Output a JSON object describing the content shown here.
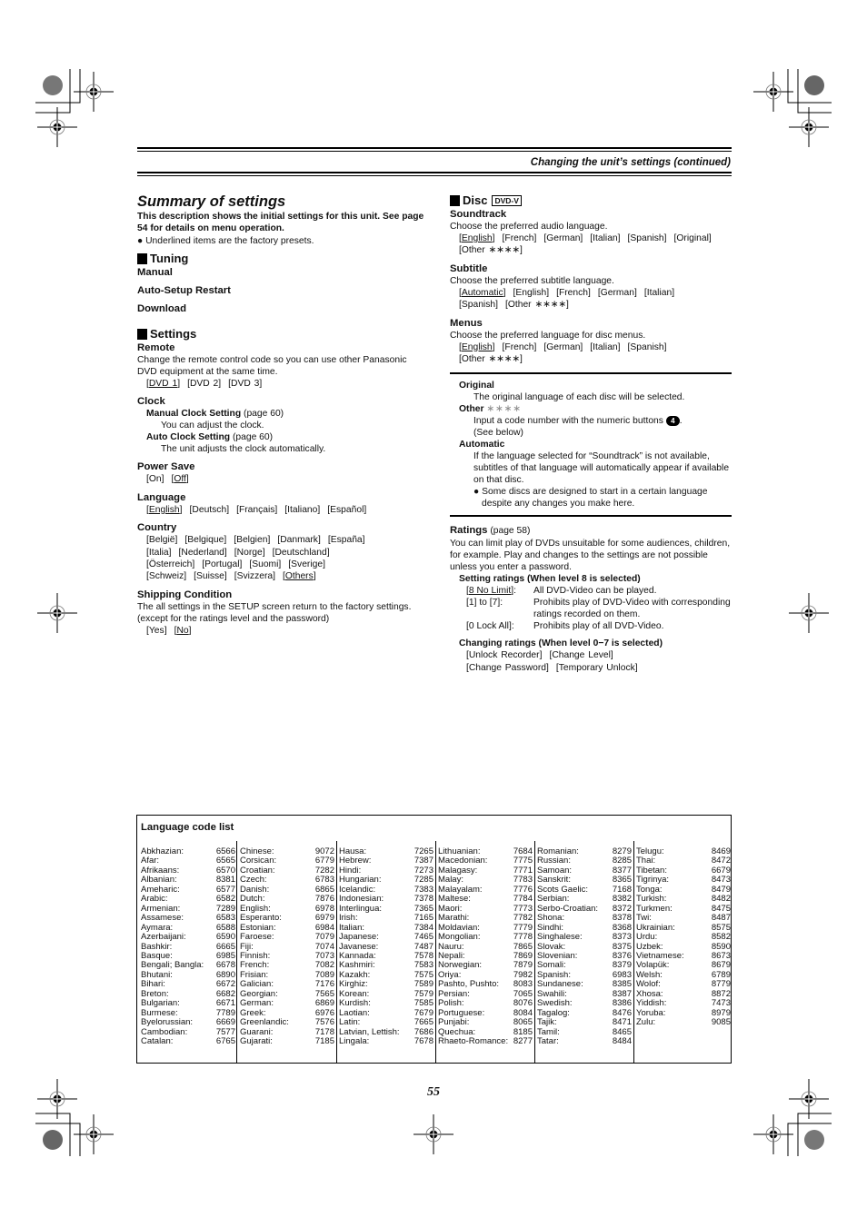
{
  "header": {
    "running_title": "Changing the unit’s settings (continued)"
  },
  "left": {
    "title": "Summary of settings",
    "intro": "This description shows the initial settings for this unit. See page 54 for details on menu operation.",
    "note": "Underlined items are the factory presets.",
    "tuning": {
      "heading": "Tuning",
      "items": [
        "Manual",
        "Auto-Setup Restart",
        "Download"
      ]
    },
    "settings": {
      "heading": "Settings",
      "remote": {
        "label": "Remote",
        "desc": "Change the remote control code so you can use other Panasonic DVD equipment at the same time.",
        "options": [
          {
            "label": "DVD 1",
            "default": true
          },
          {
            "label": "DVD 2",
            "default": false
          },
          {
            "label": "DVD 3",
            "default": false
          }
        ]
      },
      "clock": {
        "label": "Clock",
        "manual_label": "Manual Clock Setting",
        "manual_ref": "(page 60)",
        "manual_desc": "You can adjust the clock.",
        "auto_label": "Auto Clock Setting",
        "auto_ref": "(page 60)",
        "auto_desc": "The unit adjusts the clock automatically."
      },
      "power_save": {
        "label": "Power Save",
        "options": [
          {
            "label": "On",
            "default": false
          },
          {
            "label": "Off",
            "default": true
          }
        ]
      },
      "language": {
        "label": "Language",
        "options": [
          {
            "label": "English",
            "default": true
          },
          {
            "label": "Deutsch",
            "default": false
          },
          {
            "label": "Français",
            "default": false
          },
          {
            "label": "Italiano",
            "default": false
          },
          {
            "label": "Español",
            "default": false
          }
        ]
      },
      "country": {
        "label": "Country",
        "rows": [
          [
            {
              "label": "België",
              "default": false
            },
            {
              "label": "Belgique",
              "default": false
            },
            {
              "label": "Belgien",
              "default": false
            },
            {
              "label": "Danmark",
              "default": false
            },
            {
              "label": "España",
              "default": false
            }
          ],
          [
            {
              "label": "Italia",
              "default": false
            },
            {
              "label": "Nederland",
              "default": false
            },
            {
              "label": "Norge",
              "default": false
            },
            {
              "label": "Deutschland",
              "default": false
            }
          ],
          [
            {
              "label": "Österreich",
              "default": false
            },
            {
              "label": "Portugal",
              "default": false
            },
            {
              "label": "Suomi",
              "default": false
            },
            {
              "label": "Sverige",
              "default": false
            }
          ],
          [
            {
              "label": "Schweiz",
              "default": false
            },
            {
              "label": "Suisse",
              "default": false
            },
            {
              "label": "Svizzera",
              "default": false
            },
            {
              "label": "Others",
              "default": true
            }
          ]
        ]
      },
      "shipping": {
        "label": "Shipping Condition",
        "desc1": "The all settings in the SETUP screen return to the factory settings.",
        "desc2": "(except for the ratings level and the password)",
        "options": [
          {
            "label": "Yes",
            "default": false
          },
          {
            "label": "No",
            "default": true
          }
        ]
      }
    }
  },
  "right": {
    "disc": {
      "heading": "Disc",
      "badge": "DVD-V",
      "soundtrack": {
        "label": "Soundtrack",
        "desc": "Choose the preferred audio language.",
        "rows": [
          [
            {
              "label": "English",
              "default": true
            },
            {
              "label": "French",
              "default": false
            },
            {
              "label": "German",
              "default": false
            },
            {
              "label": "Italian",
              "default": false
            },
            {
              "label": "Spanish",
              "default": false
            },
            {
              "label": "Original",
              "default": false
            }
          ],
          [
            {
              "label": "Other ∗∗∗∗",
              "default": false
            }
          ]
        ]
      },
      "subtitle": {
        "label": "Subtitle",
        "desc": "Choose the preferred subtitle language.",
        "rows": [
          [
            {
              "label": "Automatic",
              "default": true
            },
            {
              "label": "English",
              "default": false
            },
            {
              "label": "French",
              "default": false
            },
            {
              "label": "German",
              "default": false
            },
            {
              "label": "Italian",
              "default": false
            }
          ],
          [
            {
              "label": "Spanish",
              "default": false
            },
            {
              "label": "Other ∗∗∗∗",
              "default": false
            }
          ]
        ]
      },
      "menus": {
        "label": "Menus",
        "desc": "Choose the preferred language for disc menus.",
        "rows": [
          [
            {
              "label": "English",
              "default": true
            },
            {
              "label": "French",
              "default": false
            },
            {
              "label": "German",
              "default": false
            },
            {
              "label": "Italian",
              "default": false
            },
            {
              "label": "Spanish",
              "default": false
            }
          ],
          [
            {
              "label": "Other ∗∗∗∗",
              "default": false
            }
          ]
        ]
      }
    },
    "notes": {
      "original_label": "Original",
      "original_desc": "The original language of each disc will be selected.",
      "other_label": "Other",
      "other_stars": "∗∗∗∗",
      "other_desc_pre": "Input a code number with the numeric buttons",
      "other_button": "4",
      "other_desc_post": ".",
      "other_see": "(See below)",
      "automatic_label": "Automatic",
      "automatic_desc": "If the language selected for “Soundtrack” is not available, subtitles of that language will automatically appear if available on that disc.",
      "bullet": "Some discs are designed to start in a certain language despite any changes you make here."
    },
    "ratings": {
      "label": "Ratings",
      "ref": "(page 58)",
      "desc": "You can limit play of DVDs unsuitable for some audiences, children, for example. Play and changes to the settings are not possible unless you enter a password.",
      "setting_heading": "Setting ratings (When level 8 is selected)",
      "setting_rows": [
        {
          "key": "8 No Limit",
          "default": true,
          "value": "All DVD-Video can be played."
        },
        {
          "key": "1] to [7",
          "default": false,
          "value": "Prohibits play of DVD-Video with corresponding ratings recorded on them."
        },
        {
          "key": "0 Lock All",
          "default": false,
          "value": "Prohibits play of all DVD-Video."
        }
      ],
      "changing_heading": "Changing ratings (When level 0−7 is selected)",
      "changing_rows": [
        [
          "Unlock Recorder",
          "Change Level"
        ],
        [
          "Change Password",
          "Temporary Unlock"
        ]
      ]
    }
  },
  "language_codes": {
    "title": "Language code list",
    "columns": [
      [
        [
          "Abkhazian:",
          "6566"
        ],
        [
          "Afar:",
          "6565"
        ],
        [
          "Afrikaans:",
          "6570"
        ],
        [
          "Albanian:",
          "8381"
        ],
        [
          "Ameharic:",
          "6577"
        ],
        [
          "Arabic:",
          "6582"
        ],
        [
          "Armenian:",
          "7289"
        ],
        [
          "Assamese:",
          "6583"
        ],
        [
          "Aymara:",
          "6588"
        ],
        [
          "Azerbaijani:",
          "6590"
        ],
        [
          "Bashkir:",
          "6665"
        ],
        [
          "Basque:",
          "6985"
        ],
        [
          "Bengali; Bangla:",
          "6678"
        ],
        [
          "Bhutani:",
          "6890"
        ],
        [
          "Bihari:",
          "6672"
        ],
        [
          "Breton:",
          "6682"
        ],
        [
          "Bulgarian:",
          "6671"
        ],
        [
          "Burmese:",
          "7789"
        ],
        [
          "Byelorussian:",
          "6669"
        ],
        [
          "Cambodian:",
          "7577"
        ],
        [
          "Catalan:",
          "6765"
        ]
      ],
      [
        [
          "Chinese:",
          "9072"
        ],
        [
          "Corsican:",
          "6779"
        ],
        [
          "Croatian:",
          "7282"
        ],
        [
          "Czech:",
          "6783"
        ],
        [
          "Danish:",
          "6865"
        ],
        [
          "Dutch:",
          "7876"
        ],
        [
          "English:",
          "6978"
        ],
        [
          "Esperanto:",
          "6979"
        ],
        [
          "Estonian:",
          "6984"
        ],
        [
          "Faroese:",
          "7079"
        ],
        [
          "Fiji:",
          "7074"
        ],
        [
          "Finnish:",
          "7073"
        ],
        [
          "French:",
          "7082"
        ],
        [
          "Frisian:",
          "7089"
        ],
        [
          "Galician:",
          "7176"
        ],
        [
          "Georgian:",
          "7565"
        ],
        [
          "German:",
          "6869"
        ],
        [
          "Greek:",
          "6976"
        ],
        [
          "Greenlandic:",
          "7576"
        ],
        [
          "Guarani:",
          "7178"
        ],
        [
          "Gujarati:",
          "7185"
        ]
      ],
      [
        [
          "Hausa:",
          "7265"
        ],
        [
          "Hebrew:",
          "7387"
        ],
        [
          "Hindi:",
          "7273"
        ],
        [
          "Hungarian:",
          "7285"
        ],
        [
          "Icelandic:",
          "7383"
        ],
        [
          "Indonesian:",
          "7378"
        ],
        [
          "Interlingua:",
          "7365"
        ],
        [
          "Irish:",
          "7165"
        ],
        [
          "Italian:",
          "7384"
        ],
        [
          "Japanese:",
          "7465"
        ],
        [
          "Javanese:",
          "7487"
        ],
        [
          "Kannada:",
          "7578"
        ],
        [
          "Kashmiri:",
          "7583"
        ],
        [
          "Kazakh:",
          "7575"
        ],
        [
          "Kirghiz:",
          "7589"
        ],
        [
          "Korean:",
          "7579"
        ],
        [
          "Kurdish:",
          "7585"
        ],
        [
          "Laotian:",
          "7679"
        ],
        [
          "Latin:",
          "7665"
        ],
        [
          "Latvian, Lettish:",
          "7686"
        ],
        [
          "Lingala:",
          "7678"
        ]
      ],
      [
        [
          "Lithuanian:",
          "7684"
        ],
        [
          "Macedonian:",
          "7775"
        ],
        [
          "Malagasy:",
          "7771"
        ],
        [
          "Malay:",
          "7783"
        ],
        [
          "Malayalam:",
          "7776"
        ],
        [
          "Maltese:",
          "7784"
        ],
        [
          "Maori:",
          "7773"
        ],
        [
          "Marathi:",
          "7782"
        ],
        [
          "Moldavian:",
          "7779"
        ],
        [
          "Mongolian:",
          "7778"
        ],
        [
          "Nauru:",
          "7865"
        ],
        [
          "Nepali:",
          "7869"
        ],
        [
          "Norwegian:",
          "7879"
        ],
        [
          "Oriya:",
          "7982"
        ],
        [
          "Pashto, Pushto:",
          "8083"
        ],
        [
          "Persian:",
          "7065"
        ],
        [
          "Polish:",
          "8076"
        ],
        [
          "Portuguese:",
          "8084"
        ],
        [
          "Punjabi:",
          "8065"
        ],
        [
          "Quechua:",
          "8185"
        ],
        [
          "Rhaeto-Romance:",
          "8277"
        ]
      ],
      [
        [
          "Romanian:",
          "8279"
        ],
        [
          "Russian:",
          "8285"
        ],
        [
          "Samoan:",
          "8377"
        ],
        [
          "Sanskrit:",
          "8365"
        ],
        [
          "Scots Gaelic:",
          "7168"
        ],
        [
          "Serbian:",
          "8382"
        ],
        [
          "Serbo-Croatian:",
          "8372"
        ],
        [
          "Shona:",
          "8378"
        ],
        [
          "Sindhi:",
          "8368"
        ],
        [
          "Singhalese:",
          "8373"
        ],
        [
          "Slovak:",
          "8375"
        ],
        [
          "Slovenian:",
          "8376"
        ],
        [
          "Somali:",
          "8379"
        ],
        [
          "Spanish:",
          "6983"
        ],
        [
          "Sundanese:",
          "8385"
        ],
        [
          "Swahili:",
          "8387"
        ],
        [
          "Swedish:",
          "8386"
        ],
        [
          "Tagalog:",
          "8476"
        ],
        [
          "Tajik:",
          "8471"
        ],
        [
          "Tamil:",
          "8465"
        ],
        [
          "Tatar:",
          "8484"
        ]
      ],
      [
        [
          "Telugu:",
          "8469"
        ],
        [
          "Thai:",
          "8472"
        ],
        [
          "Tibetan:",
          "6679"
        ],
        [
          "Tigrinya:",
          "8473"
        ],
        [
          "Tonga:",
          "8479"
        ],
        [
          "Turkish:",
          "8482"
        ],
        [
          "Turkmen:",
          "8475"
        ],
        [
          "Twi:",
          "8487"
        ],
        [
          "Ukrainian:",
          "8575"
        ],
        [
          "Urdu:",
          "8582"
        ],
        [
          "Uzbek:",
          "8590"
        ],
        [
          "Vietnamese:",
          "8673"
        ],
        [
          "Volapük:",
          "8679"
        ],
        [
          "Welsh:",
          "6789"
        ],
        [
          "Wolof:",
          "8779"
        ],
        [
          "Xhosa:",
          "8872"
        ],
        [
          "Yiddish:",
          "7473"
        ],
        [
          "Yoruba:",
          "8979"
        ],
        [
          "Zulu:",
          "9085"
        ]
      ]
    ]
  },
  "footer": {
    "page_number": "55"
  }
}
